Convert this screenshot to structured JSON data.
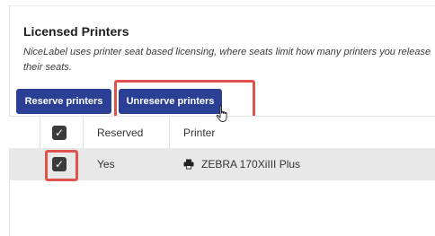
{
  "section": {
    "title": "Licensed Printers",
    "description": "NiceLabel uses printer seat based licensing, where seats limit how many printers you release their seats."
  },
  "toolbar": {
    "reserve_label": "Reserve printers",
    "unreserve_label": "Unreserve printers"
  },
  "table": {
    "headers": {
      "reserved": "Reserved",
      "printer": "Printer"
    },
    "rows": [
      {
        "checked": true,
        "reserved": "Yes",
        "printer": "ZEBRA 170XiIII Plus"
      }
    ]
  },
  "colors": {
    "accent": "#2b3f94",
    "highlight": "#e0534d"
  },
  "icons": {
    "checkbox": "checkmark-icon",
    "printer": "printer-icon",
    "cursor": "hand-pointer-icon"
  }
}
